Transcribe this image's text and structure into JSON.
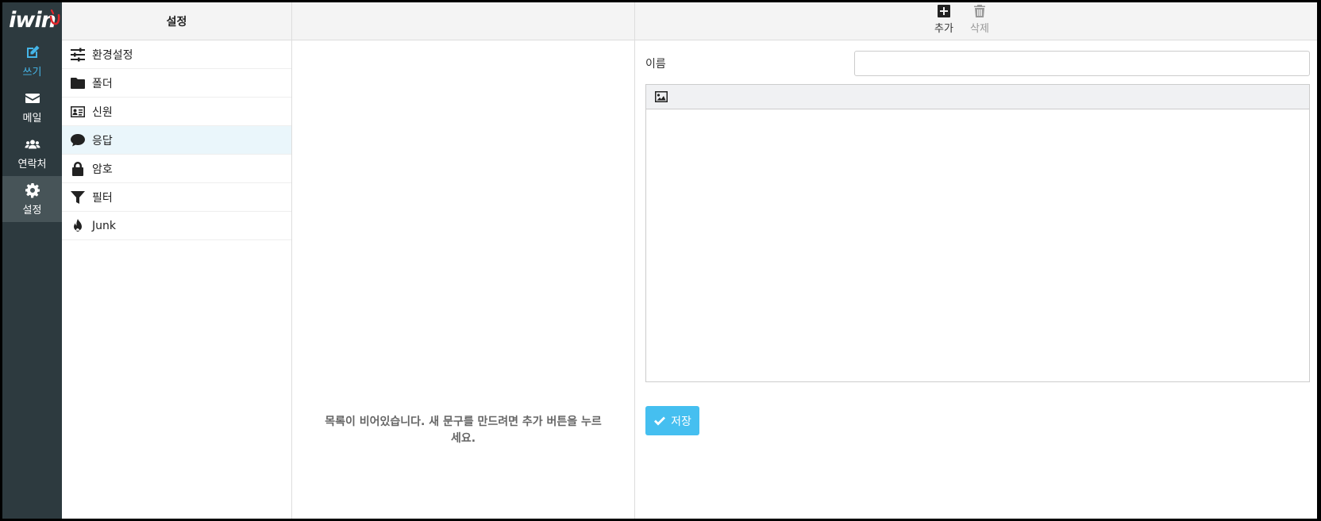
{
  "app": {
    "logo_text": "iwin"
  },
  "nav": {
    "items": [
      {
        "label": "쓰기",
        "icon": "compose-icon"
      },
      {
        "label": "메일",
        "icon": "envelope-icon"
      },
      {
        "label": "연락처",
        "icon": "users-icon"
      },
      {
        "label": "설정",
        "icon": "gear-icon"
      }
    ],
    "active_index": 3
  },
  "settings": {
    "header": "설정",
    "items": [
      {
        "label": "환경설정",
        "icon": "sliders-icon"
      },
      {
        "label": "폴더",
        "icon": "folder-icon"
      },
      {
        "label": "신원",
        "icon": "id-card-icon"
      },
      {
        "label": "응답",
        "icon": "comment-icon"
      },
      {
        "label": "암호",
        "icon": "lock-icon"
      },
      {
        "label": "필터",
        "icon": "filter-icon"
      },
      {
        "label": "Junk",
        "icon": "fire-icon"
      }
    ],
    "selected_index": 3
  },
  "list": {
    "empty_message": "목록이 비어있습니다. 새 문구를 만드려면 추가 버튼을 누르세요."
  },
  "toolbar": {
    "add_label": "추가",
    "delete_label": "삭제"
  },
  "editor": {
    "name_label": "이름",
    "name_value": "",
    "save_label": "저장"
  },
  "colors": {
    "rail_bg": "#2d3a3f",
    "accent": "#45bff0",
    "selected_row": "#eaf6fb"
  }
}
